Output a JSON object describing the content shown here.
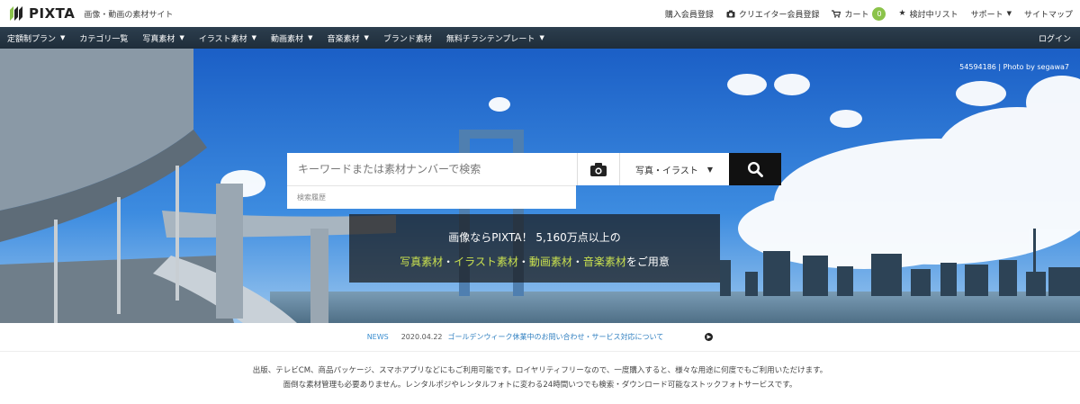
{
  "header": {
    "logo_text": "PIXTA",
    "tagline": "画像・動画の素材サイト",
    "links": {
      "buyer_register": "購入会員登録",
      "creator_register": "クリエイター会員登録",
      "cart": "カート",
      "cart_count": "0",
      "watchlist": "検討中リスト",
      "support": "サポート",
      "sitemap": "サイトマップ"
    }
  },
  "nav": {
    "items": [
      {
        "label": "定額制プラン"
      },
      {
        "label": "カテゴリ一覧"
      },
      {
        "label": "写真素材"
      },
      {
        "label": "イラスト素材"
      },
      {
        "label": "動画素材"
      },
      {
        "label": "音楽素材"
      },
      {
        "label": "ブランド素材"
      },
      {
        "label": "無料チラシテンプレート"
      }
    ],
    "login": "ログイン"
  },
  "hero": {
    "credit": "54594186 | Photo by segawa7",
    "search": {
      "placeholder": "キーワードまたは素材ナンバーで検索",
      "type_selected": "写真・イラスト",
      "history_label": "検索履歴"
    },
    "promo": {
      "line1": "画像ならPIXTA！ 5,160万点以上の",
      "photo": "写真素材",
      "illust": "イラスト素材",
      "video": "動画素材",
      "music": "音楽素材",
      "sep": "・",
      "suffix": "をご用意"
    }
  },
  "news": {
    "label": "NEWS",
    "date": "2020.04.22",
    "text": "ゴールデンウィーク休業中のお問い合わせ・サービス対応について"
  },
  "description": {
    "line1": "出版、テレビCM、商品パッケージ、スマホアプリなどにもご利用可能です。ロイヤリティフリーなので、一度購入すると、様々な用途に何度でもご利用いただけます。",
    "line2": "面倒な素材管理も必要ありません。レンタルポジやレンタルフォトに変わる24時間いつでも検索・ダウンロード可能なストックフォトサービスです。"
  },
  "colors": {
    "nav_bg": "#243444",
    "accent_green": "#8bc34a",
    "promo_highlight": "#c9e04f",
    "link_blue": "#2f7fc0"
  }
}
